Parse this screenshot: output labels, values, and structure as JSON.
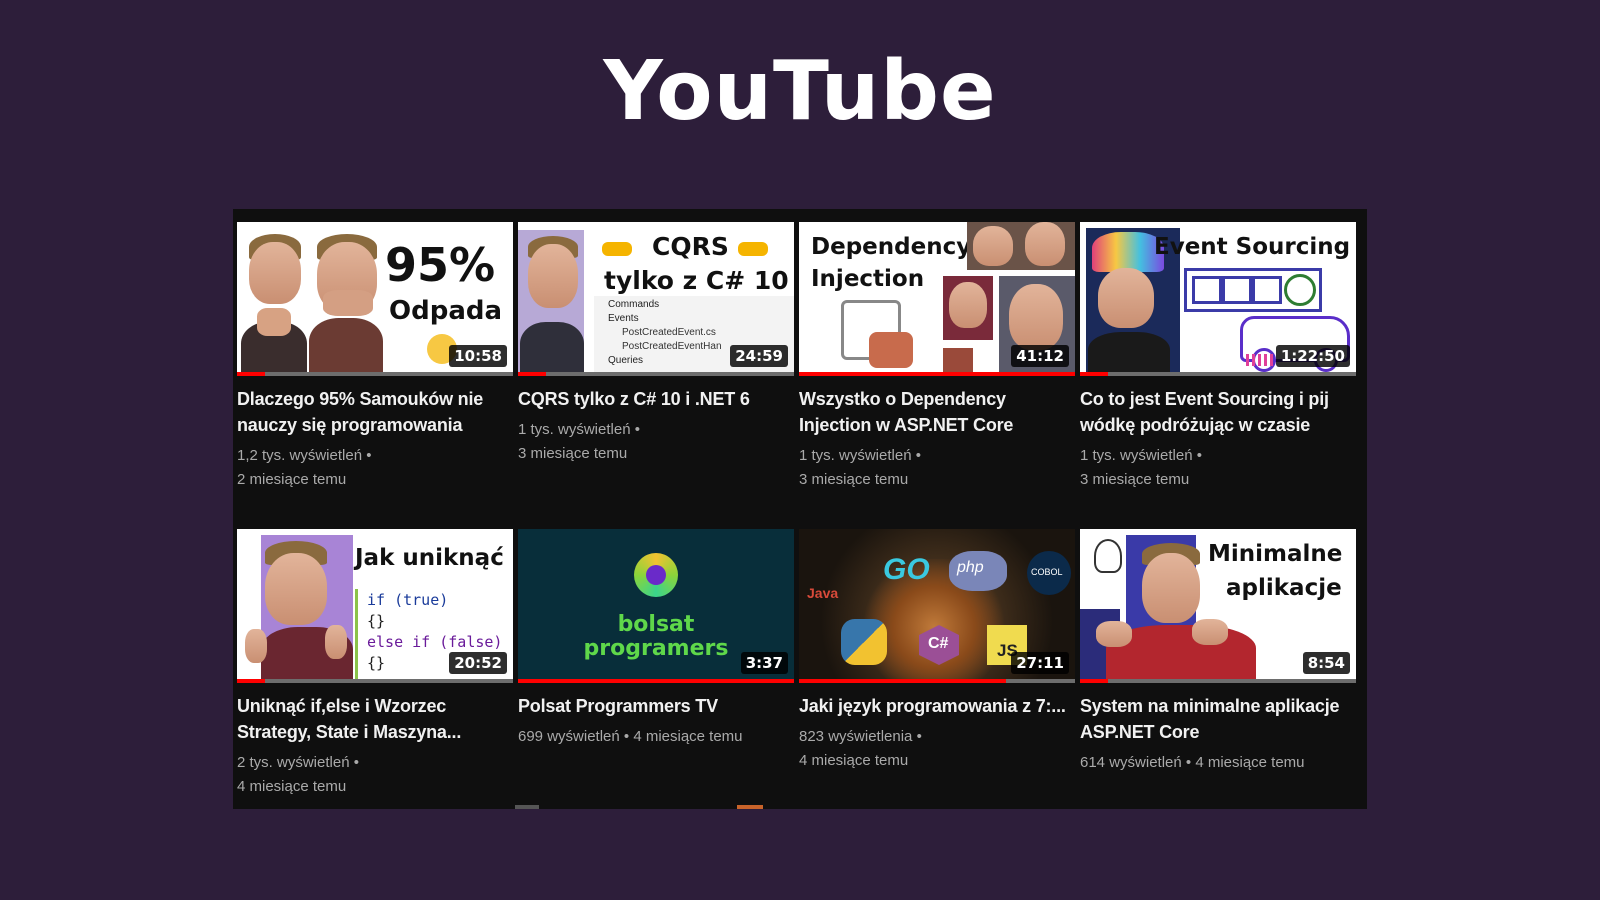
{
  "page": {
    "title": "YouTube"
  },
  "videos": [
    {
      "title": "Dlaczego 95% Samouków nie nauczy się programowania",
      "duration": "10:58",
      "views": "1,2 tys. wyświetleń",
      "age": "2 miesiące temu",
      "thumb_text": [
        "95%",
        "Odpada"
      ],
      "progress": 0.1
    },
    {
      "title": "CQRS tylko z C# 10 i .NET 6",
      "duration": "24:59",
      "views": "1 tys. wyświetleń",
      "age": "3 miesiące temu",
      "thumb_text": [
        "CQRS",
        "tylko z C# 10",
        "Commands",
        "Events",
        "PostCreatedEvent.cs",
        "PostCreatedEventHan",
        "Queries"
      ],
      "progress": 0.1
    },
    {
      "title": "Wszystko o Dependency Injection w ASP.NET Core",
      "duration": "41:12",
      "views": "1 tys. wyświetleń",
      "age": "3 miesiące temu",
      "thumb_text": [
        "Dependency",
        "Injection"
      ],
      "progress": 1.0
    },
    {
      "title": "Co to jest Event Sourcing i pij wódkę podróżując w czasie",
      "duration": "1:22:50",
      "views": "1 tys. wyświetleń",
      "age": "3 miesiące temu",
      "thumb_text": [
        "Event Sourcing"
      ],
      "progress": 0.1
    },
    {
      "title": "Uniknąć if,else i Wzorzec Strategy, State i Maszyna...",
      "duration": "20:52",
      "views": "2 tys. wyświetleń",
      "age": "4 miesiące temu",
      "thumb_text": [
        "Jak uniknąć",
        "if (true)",
        "{}",
        "else if (false)",
        "{}"
      ],
      "progress": 0.1
    },
    {
      "title": "Polsat Programmers TV",
      "duration": "3:37",
      "views": "699 wyświetleń",
      "age": "4 miesiące temu",
      "thumb_text": [
        "bolsat",
        "programers"
      ],
      "progress": 1.0
    },
    {
      "title": "Jaki język programowania z 7:...",
      "duration": "27:11",
      "views": "823 wyświetlenia",
      "age": "4 miesiące temu",
      "thumb_text": [
        "Java",
        "GO",
        "php",
        "COBOL",
        "C#",
        "JS"
      ],
      "progress": 0.75
    },
    {
      "title": "System na minimalne aplikacje ASP.NET Core",
      "duration": "8:54",
      "views": "614 wyświetleń",
      "age": "4 miesiące temu",
      "thumb_text": [
        "Minimalne",
        "aplikacje"
      ],
      "progress": 0.1
    }
  ],
  "colors": {
    "background": "#2d1e3a",
    "panel": "#0f0f0f",
    "progress": "#ff0000"
  }
}
